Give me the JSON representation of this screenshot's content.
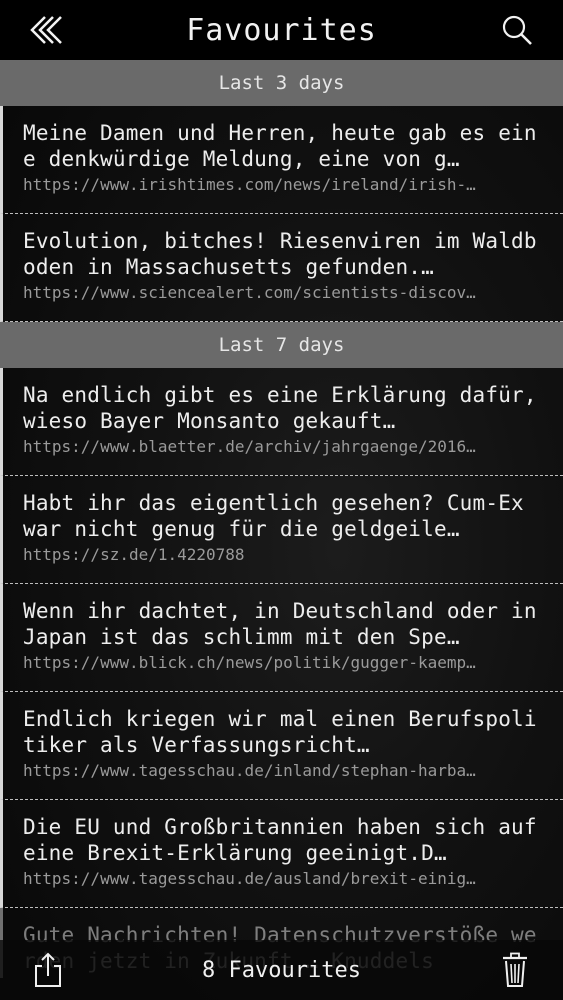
{
  "navbar": {
    "title": "Favourites",
    "back_icon": "double-chevron-left-icon",
    "search_icon": "search-icon"
  },
  "sections": [
    {
      "header": "Last 3 days",
      "items": [
        {
          "title": "Meine Damen und Herren, heute gab es eine denkwürdige Meldung, eine von g…",
          "url": "https://www.irishtimes.com/news/ireland/irish-…"
        },
        {
          "title": "Evolution, bitches! Riesenviren im Waldboden in Massachusetts gefunden.…",
          "url": "https://www.sciencealert.com/scientists-discov…"
        }
      ]
    },
    {
      "header": "Last 7 days",
      "items": [
        {
          "title": "Na endlich gibt es eine Erklärung dafür, wieso Bayer Monsanto gekauft…",
          "url": "https://www.blaetter.de/archiv/jahrgaenge/2016…"
        },
        {
          "title": "Habt ihr das eigentlich gesehen? Cum-Ex war nicht genug für die geldgeile…",
          "url": "https://sz.de/1.4220788"
        },
        {
          "title": "Wenn ihr dachtet, in Deutschland oder in Japan ist das schlimm mit den Spe…",
          "url": "https://www.blick.ch/news/politik/gugger-kaemp…"
        },
        {
          "title": "Endlich kriegen wir mal einen Berufspolitiker als Verfassungsricht…",
          "url": "https://www.tagesschau.de/inland/stephan-harba…"
        },
        {
          "title": "Die EU und Großbritannien haben sich auf eine Brexit-Erklärung geeinigt.D…",
          "url": "https://www.tagesschau.de/ausland/brexit-einig…"
        },
        {
          "title": "Gute Nachrichten! Datenschutzverstöße werden jetzt in Zukunft … Knuddels",
          "url": ""
        }
      ]
    }
  ],
  "toolbar": {
    "count_label": "8 Favourites",
    "share_icon": "share-icon",
    "trash_icon": "trash-icon"
  },
  "colors": {
    "navbar_bg": "#000000",
    "section_header_bg": "#6a6a6a",
    "text": "#ededed",
    "url_text": "#9a9a9a"
  }
}
